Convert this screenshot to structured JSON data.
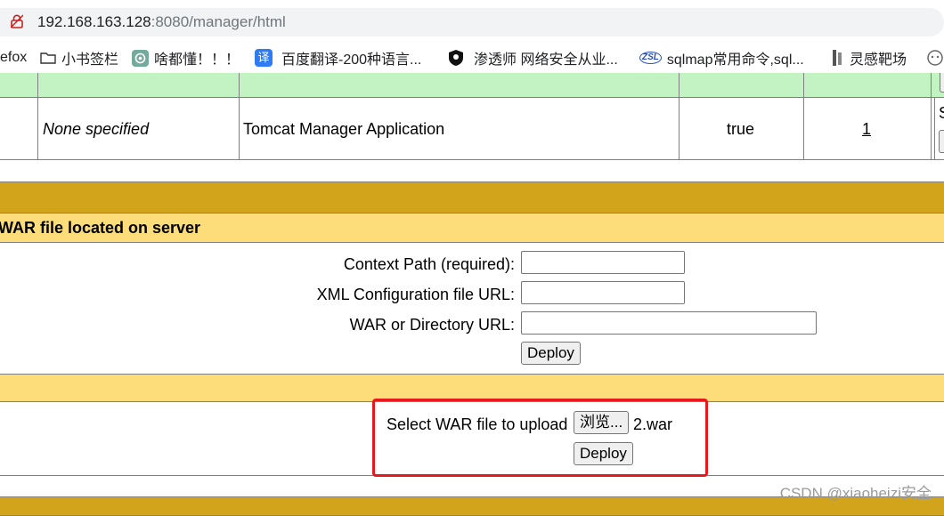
{
  "browser": {
    "url_host": "192.168.163.128",
    "url_rest": ":8080/manager/html",
    "bookmarks": [
      {
        "label": "efox",
        "icon": "firefox-icon"
      },
      {
        "label": "小书签栏",
        "icon": "folder-icon"
      },
      {
        "label": "啥都懂！！！",
        "icon": "chatgpt-icon"
      },
      {
        "label": "百度翻译-200种语言...",
        "icon": "translate-icon",
        "icon_char": "译"
      },
      {
        "label": "渗透师 网络安全从业...",
        "icon": "shield-icon"
      },
      {
        "label": "sqlmap常用命令,sql...",
        "icon": "zsl-icon",
        "icon_char": "ZSL"
      },
      {
        "label": "灵感靶场",
        "icon": "target-icon"
      }
    ]
  },
  "apps_table": {
    "row": {
      "version": "None specified",
      "display_name": "Tomcat Manager Application",
      "running": "true",
      "sessions": "1",
      "commands_partial": "S"
    }
  },
  "deploy_server": {
    "title": "WAR file located on server",
    "context_path_label": "Context Path (required):",
    "context_path_value": "",
    "xml_config_label": "XML Configuration file URL:",
    "xml_config_value": "",
    "war_url_label": "WAR or Directory URL:",
    "war_url_value": "",
    "deploy_label": "Deploy"
  },
  "deploy_upload": {
    "select_label": "Select WAR file to upload",
    "browse_label": "浏览...",
    "file_name": "2.war",
    "deploy_label": "Deploy"
  },
  "watermark": "CSDN @xiaoheizi安全",
  "colors": {
    "green_header": "#c3f3c3",
    "gold_bar": "#d2a41c",
    "yellow_bar": "#fddd7a",
    "highlight_red": "#e8191d"
  }
}
